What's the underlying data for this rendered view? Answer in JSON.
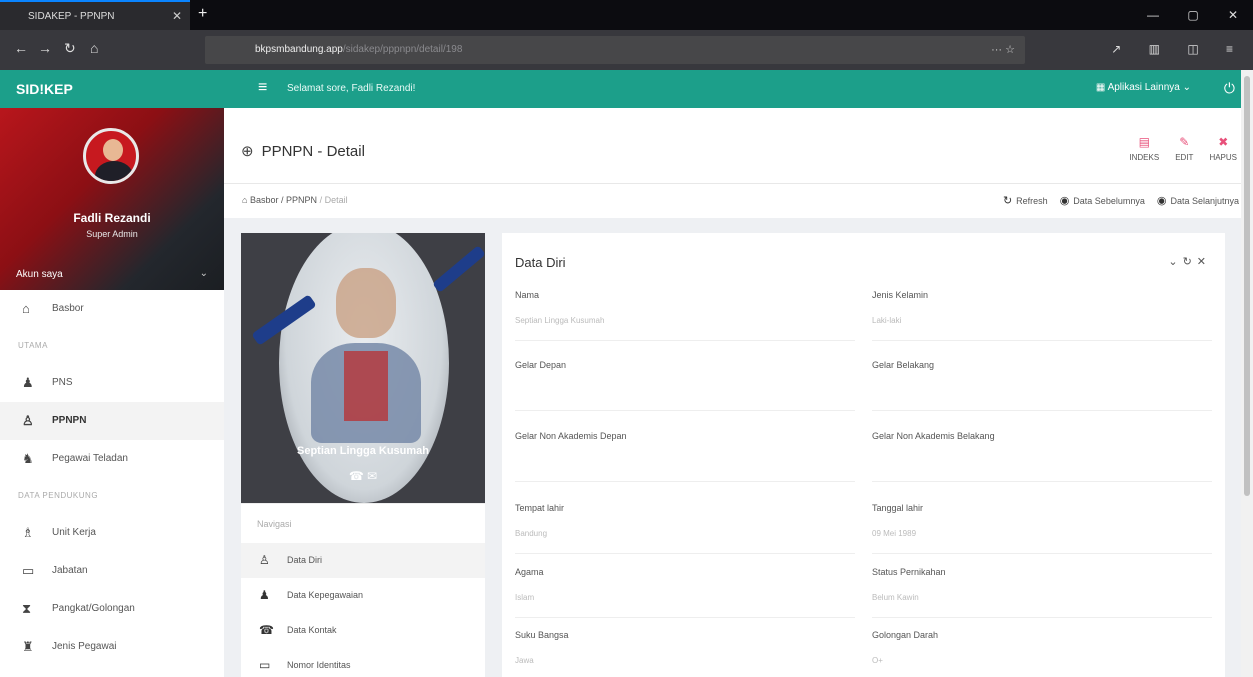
{
  "browser": {
    "tab_title": "SIDAKEP - PPNPN",
    "url_host": "bkpsmbandung.app",
    "url_path": "/sidakep/pppnpn/detail/198"
  },
  "header": {
    "brand": "SID!KEP",
    "welcome": "Selamat sore, Fadli Rezandi!",
    "other_apps": "Aplikasi Lainnya"
  },
  "profile": {
    "name": "Fadli Rezandi",
    "role": "Super Admin",
    "account_label": "Akun saya"
  },
  "sidebar": {
    "items_top": [
      {
        "label": "Basbor",
        "icon": "home-icon"
      }
    ],
    "section_utama": "UTAMA",
    "items_utama": [
      {
        "label": "PNS",
        "icon": "user-tie-icon"
      },
      {
        "label": "PPNPN",
        "icon": "user-icon",
        "active": true
      },
      {
        "label": "Pegawai Teladan",
        "icon": "user-star-icon"
      }
    ],
    "section_pendukung": "DATA PENDUKUNG",
    "items_pendukung": [
      {
        "label": "Unit Kerja",
        "icon": "sitemap-icon"
      },
      {
        "label": "Jabatan",
        "icon": "id-card-icon"
      },
      {
        "label": "Pangkat/Golongan",
        "icon": "rank-icon"
      },
      {
        "label": "Jenis Pegawai",
        "icon": "users-icon"
      }
    ]
  },
  "page": {
    "title": "PPNPN - Detail",
    "actions": {
      "index": "INDEKS",
      "edit": "EDIT",
      "delete": "HAPUS"
    },
    "breadcrumb": {
      "home": "Basbor",
      "sep": "/",
      "parent": "PPNPN",
      "current": "Detail"
    },
    "refresh": "Refresh",
    "prev": "Data Sebelumnya",
    "next": "Data Selanjutnya"
  },
  "person": {
    "name": "Septian Lingga Kusumah",
    "nav_label": "Navigasi",
    "nav": [
      {
        "label": "Data Diri",
        "active": true
      },
      {
        "label": "Data Kepegawaian"
      },
      {
        "label": "Data Kontak"
      },
      {
        "label": "Nomor Identitas"
      }
    ]
  },
  "detail": {
    "card_title": "Data Diri",
    "fields": [
      {
        "label": "Nama",
        "value": "Septian Lingga Kusumah"
      },
      {
        "label": "Jenis Kelamin",
        "value": "Laki-laki"
      },
      {
        "label": "Gelar Depan",
        "value": ""
      },
      {
        "label": "Gelar Belakang",
        "value": ""
      },
      {
        "label": "Gelar Non Akademis Depan",
        "value": ""
      },
      {
        "label": "Gelar Non Akademis Belakang",
        "value": ""
      },
      {
        "label": "Tempat lahir",
        "value": "Bandung"
      },
      {
        "label": "Tanggal lahir",
        "value": "09 Mei 1989"
      },
      {
        "label": "Agama",
        "value": "Islam"
      },
      {
        "label": "Status Pernikahan",
        "value": "Belum Kawin"
      },
      {
        "label": "Suku Bangsa",
        "value": "Jawa"
      },
      {
        "label": "Golongan Darah",
        "value": "O+"
      }
    ]
  }
}
